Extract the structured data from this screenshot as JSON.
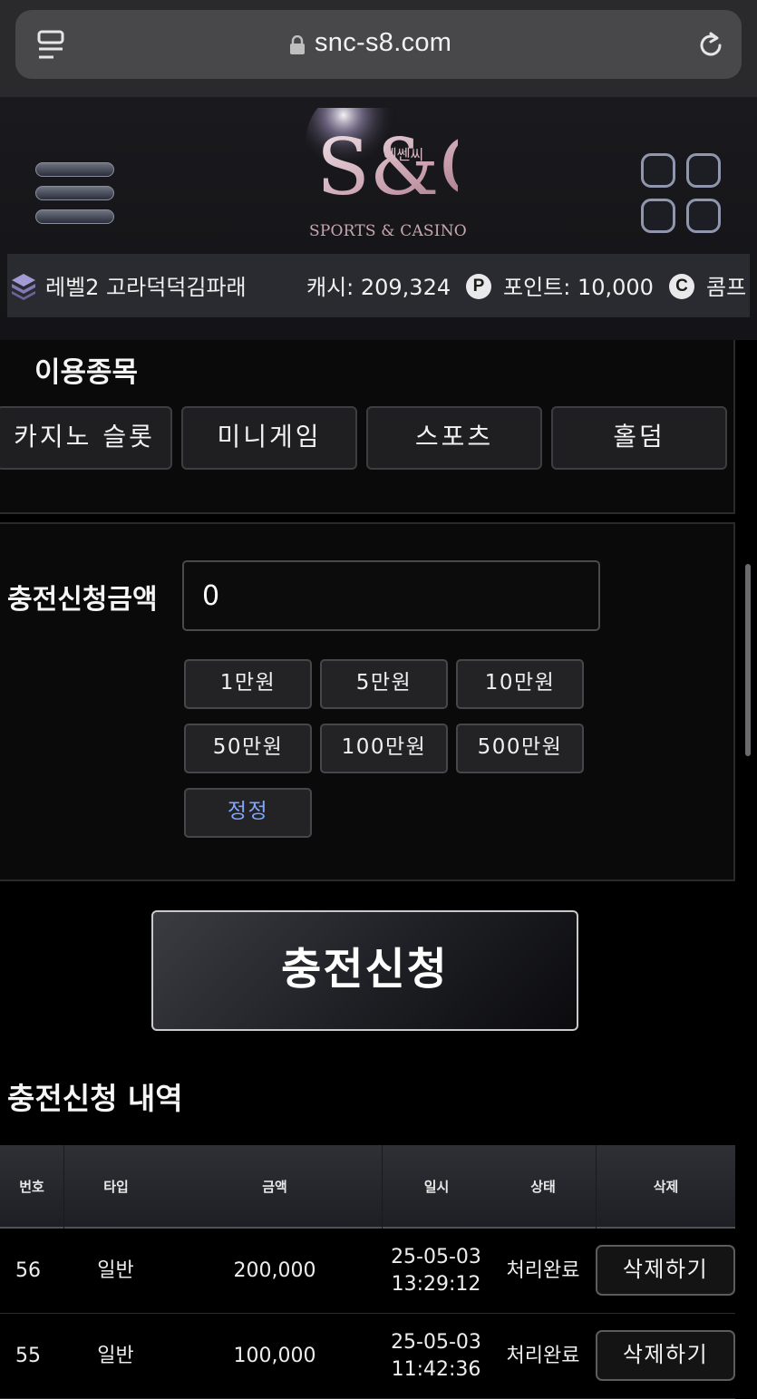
{
  "browser": {
    "url": "snc-s8.com"
  },
  "header": {
    "logo_text": "S&C",
    "logo_korean": "에쎈씨",
    "logo_sub": "SPORTS & CASINO"
  },
  "user": {
    "level_name": "레벨2 고라덕덕김파래",
    "cash_label": "캐시: 209,324",
    "point_label": "포인트: 10,000",
    "comp_label": "콤프",
    "point_icon": "P",
    "comp_icon": "C"
  },
  "games": {
    "title": "이용종목",
    "items": [
      "카지노 슬롯",
      "미니게임",
      "스포츠",
      "홀덤"
    ]
  },
  "deposit": {
    "label": "충전신청금액",
    "value": "0",
    "chips": [
      "1만원",
      "5만원",
      "10만원",
      "50만원",
      "100만원",
      "500만원"
    ],
    "reset": "정정",
    "submit": "충전신청"
  },
  "history": {
    "title": "충전신청 내역",
    "columns": [
      "번호",
      "타입",
      "금액",
      "일시",
      "상태",
      "삭제"
    ],
    "rows": [
      {
        "no": "56",
        "type": "일반",
        "amount": "200,000",
        "date": "25-05-03",
        "time": "13:29:12",
        "status": "처리완료",
        "delete": "삭제하기"
      },
      {
        "no": "55",
        "type": "일반",
        "amount": "100,000",
        "date": "25-05-03",
        "time": "11:42:36",
        "status": "처리완료",
        "delete": "삭제하기"
      }
    ]
  },
  "colors": {
    "accent_reset": "#7ea6ff",
    "background": "#000000"
  }
}
